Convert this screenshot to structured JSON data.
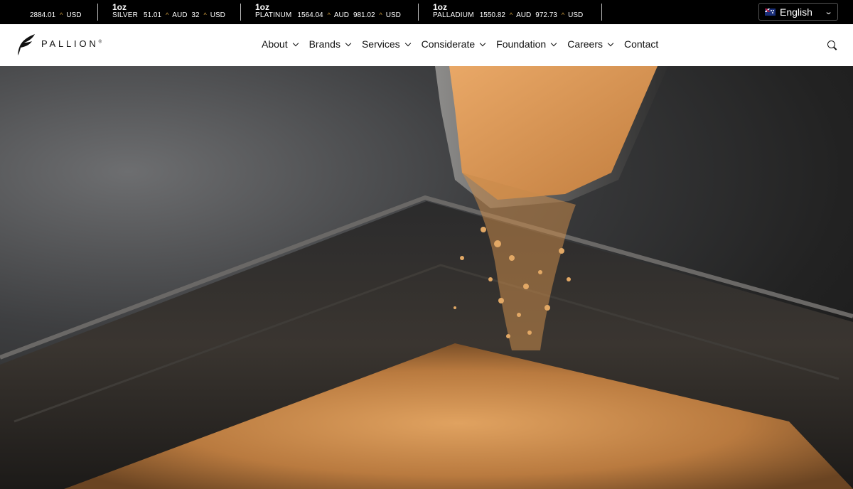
{
  "ticker": {
    "items": [
      {
        "oz": "",
        "metal": "",
        "aud": "",
        "usd": "2884.01",
        "currency": "USD"
      },
      {
        "oz": "1oz",
        "metal": "SILVER",
        "aud": "51.01",
        "aud_currency": "AUD",
        "usd": "32",
        "currency": "USD"
      },
      {
        "oz": "1oz",
        "metal": "PLATINUM",
        "aud": "1564.04",
        "aud_currency": "AUD",
        "usd": "981.02",
        "currency": "USD"
      },
      {
        "oz": "1oz",
        "metal": "PALLADIUM",
        "aud": "1550.82",
        "aud_currency": "AUD",
        "usd": "972.73",
        "currency": "USD"
      }
    ]
  },
  "language": {
    "label": "English",
    "flag": "australia-flag"
  },
  "brand": {
    "name": "PALLION",
    "reg": "®"
  },
  "nav": {
    "items": [
      {
        "label": "About",
        "dropdown": true
      },
      {
        "label": "Brands",
        "dropdown": true
      },
      {
        "label": "Services",
        "dropdown": true
      },
      {
        "label": "Considerate",
        "dropdown": true
      },
      {
        "label": "Foundation",
        "dropdown": true
      },
      {
        "label": "Careers",
        "dropdown": true
      },
      {
        "label": "Contact",
        "dropdown": false
      }
    ]
  },
  "colors": {
    "accent": "#d9a441",
    "ticker_bg": "#000000",
    "header_bg": "#ffffff",
    "gold": "#c98a4a"
  }
}
